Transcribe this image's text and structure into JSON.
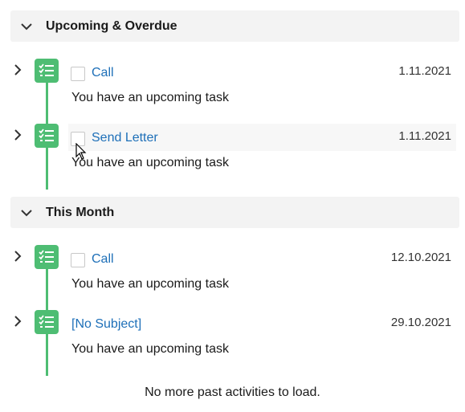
{
  "sections": [
    {
      "title": "Upcoming & Overdue",
      "activities": [
        {
          "subject": "Call",
          "date": "1.11.2021",
          "description": "You have an upcoming task"
        },
        {
          "subject": "Send Letter",
          "date": "1.11.2021",
          "description": "You have an upcoming task"
        }
      ]
    },
    {
      "title": "This Month",
      "activities": [
        {
          "subject": "Call",
          "date": "12.10.2021",
          "description": "You have an upcoming task"
        },
        {
          "subject": "[No Subject]",
          "date": "29.10.2021",
          "description": "You have an upcoming task"
        }
      ]
    }
  ],
  "footer_text": "No more past activities to load.",
  "colors": {
    "task_green": "#4ebd73",
    "link_blue": "#1d6fb8",
    "header_bg": "#f3f3f3"
  }
}
